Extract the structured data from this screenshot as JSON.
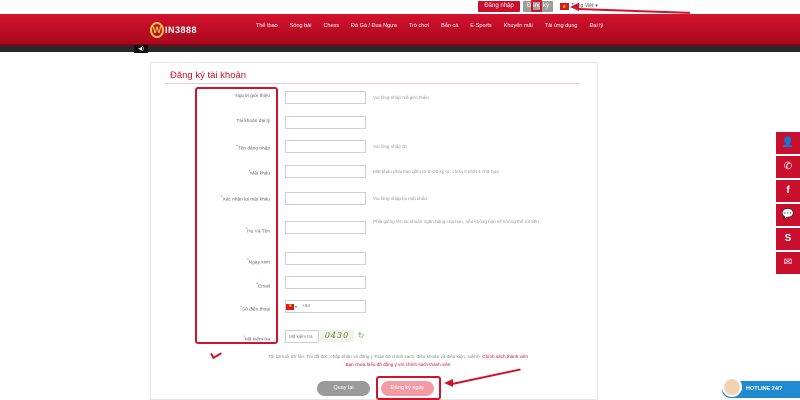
{
  "topbar": {
    "login_label": "Đăng nhập",
    "register_label": "Đăng ký",
    "language_label": "Tiếng Việt"
  },
  "header": {
    "logo_mark": "W",
    "logo_text": "IN3888",
    "nav": [
      "Thể thao",
      "Sòng bài",
      "Chess",
      "Đá Gà / Đua Ngựa",
      "Trò chơi",
      "Bắn cá",
      "E-Sports",
      "Khuyến mãi",
      "Tải ứng dụng",
      "Đại lý"
    ]
  },
  "form": {
    "title": "Đăng ký tài khoản",
    "fields": [
      {
        "label": "Người giới thiệu",
        "required": false,
        "value": "",
        "hint": "Vui lòng nhập mã giới thiệu"
      },
      {
        "label": "Tài khoản đại lý",
        "required": false,
        "value": "",
        "hint": ""
      },
      {
        "label": "Tên đăng nhập",
        "required": true,
        "value": "",
        "hint": "Vui lòng nhập ID"
      },
      {
        "label": "Mật khẩu",
        "required": true,
        "value": "",
        "hint": "Mật khẩu phải bao gồm từ 6~20 ký tự, chứa ít nhất 1 chữ hoa"
      },
      {
        "label": "Xác nhận lại mật khẩu",
        "required": true,
        "value": "",
        "hint": "Vui lòng nhập lại mật khẩu"
      },
      {
        "label": "Họ Và Tên",
        "required": true,
        "value": "",
        "hint": "Phải giống tên tài khoản ngân hàng của bạn, nếu không bạn sẽ không thể rút tiền."
      },
      {
        "label": "Ngày sinh",
        "required": true,
        "value": "",
        "hint": ""
      },
      {
        "label": "Email",
        "required": true,
        "value": "",
        "hint": ""
      },
      {
        "label": "Số điện thoại",
        "required": true,
        "value": "+84",
        "hint": ""
      },
      {
        "label": "Mã kiểm tra",
        "required": true,
        "value": "Mã kiểm tra",
        "hint": ""
      }
    ],
    "captcha_text": "0430",
    "consent_prefix": "Tôi 18 tuổi trở lên, Tôi đã đọc, chấp nhận và đồng ý Toàn bộ chính sách, điều khoản và điều kiện, luật lệ, ",
    "consent_link": "Chính sách thành viên",
    "consent_line2": "Bạn chưa hiểu đã đồng ý với chính sách thành viên",
    "back_label": "Quay lại",
    "submit_label": "Đăng ký ngay"
  },
  "sidebar_icons": [
    "user-icon",
    "phone-icon",
    "facebook-icon",
    "chat-icon",
    "skype-icon",
    "mail-icon"
  ],
  "hotline": {
    "label": "HOTLINE 24/7"
  },
  "colors": {
    "brand_red": "#c8102e",
    "annotation_red": "#d0122a",
    "hotline_blue": "#1f8ad0"
  }
}
